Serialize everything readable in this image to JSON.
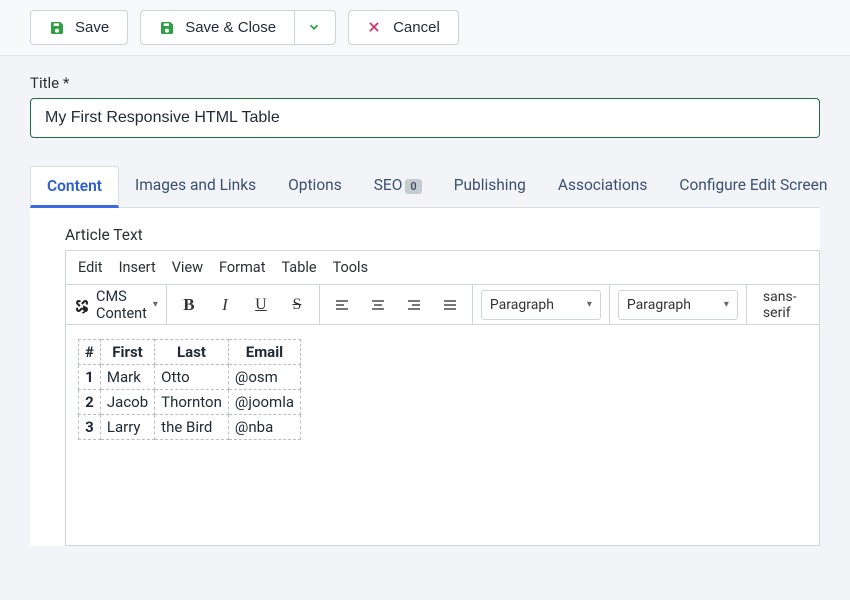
{
  "toolbar": {
    "save": "Save",
    "save_close": "Save & Close",
    "cancel": "Cancel"
  },
  "title_field": {
    "label": "Title *",
    "value": "My First Responsive HTML Table"
  },
  "tabs": [
    {
      "label": "Content",
      "active": true
    },
    {
      "label": "Images and Links"
    },
    {
      "label": "Options"
    },
    {
      "label": "SEO",
      "badge": "0"
    },
    {
      "label": "Publishing"
    },
    {
      "label": "Associations"
    },
    {
      "label": "Configure Edit Screen"
    }
  ],
  "editor": {
    "label": "Article Text",
    "menubar": [
      "Edit",
      "Insert",
      "View",
      "Format",
      "Table",
      "Tools"
    ],
    "cms_dropdown": "CMS Content",
    "format_select1": "Paragraph",
    "format_select2": "Paragraph",
    "font_select": "sans-serif"
  },
  "table": {
    "headers": [
      "#",
      "First",
      "Last",
      "Email"
    ],
    "rows": [
      {
        "n": "1",
        "first": "Mark",
        "last": "Otto",
        "email": "@osm"
      },
      {
        "n": "2",
        "first": "Jacob",
        "last": "Thornton",
        "email": "@joomla"
      },
      {
        "n": "3",
        "first": "Larry",
        "last": "the Bird",
        "email": "@nba"
      }
    ]
  }
}
